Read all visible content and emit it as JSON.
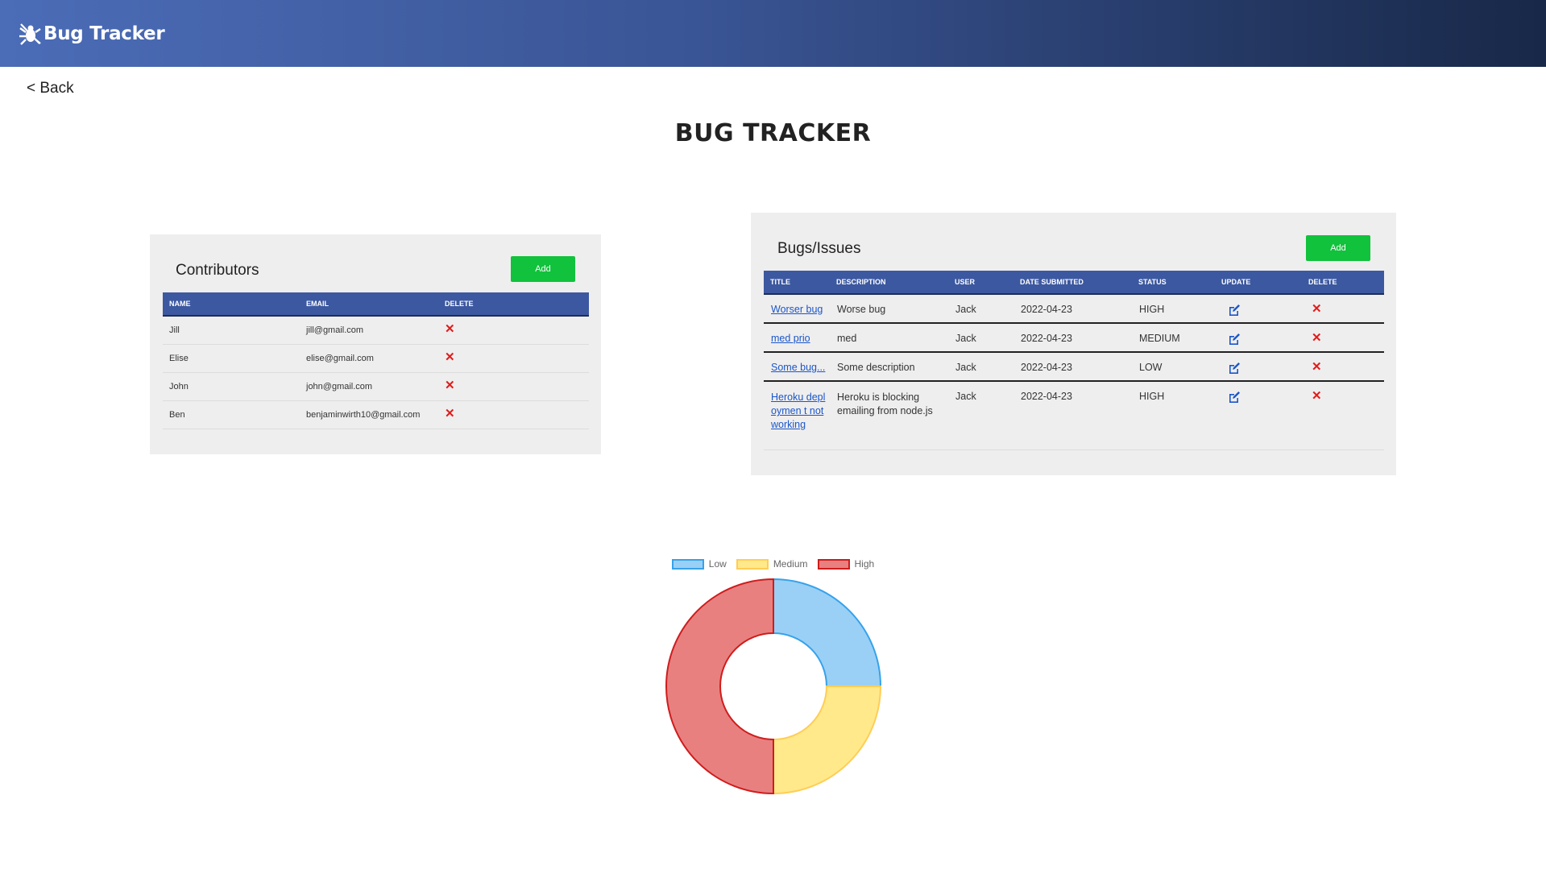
{
  "navbar": {
    "brand": "Bug Tracker",
    "icon": "bug-icon"
  },
  "back_label": "< Back",
  "page_title": "BUG TRACKER",
  "contributors": {
    "title": "Contributors",
    "add_label": "Add",
    "columns": [
      "NAME",
      "EMAIL",
      "DELETE"
    ],
    "rows": [
      {
        "name": "Jill",
        "email": "jill@gmail.com"
      },
      {
        "name": "Elise",
        "email": "elise@gmail.com"
      },
      {
        "name": "John",
        "email": "john@gmail.com"
      },
      {
        "name": "Ben",
        "email": "benjaminwirth10@gmail.com"
      }
    ]
  },
  "bugs": {
    "title": "Bugs/Issues",
    "add_label": "Add",
    "columns": [
      "TITLE",
      "DESCRIPTION",
      "USER",
      "DATE SUBMITTED",
      "STATUS",
      "UPDATE",
      "DELETE"
    ],
    "rows": [
      {
        "title": "Worser bug",
        "description": "Worse bug",
        "user": "Jack",
        "date": "2022-04-23",
        "status": "HIGH"
      },
      {
        "title": "med prio",
        "description": "med",
        "user": "Jack",
        "date": "2022-04-23",
        "status": "MEDIUM"
      },
      {
        "title": "Some bug...",
        "description": "Some description",
        "user": "Jack",
        "date": "2022-04-23",
        "status": "LOW"
      },
      {
        "title": "Heroku deploymen t not working",
        "description": "Heroku is blocking emailing from node.js",
        "user": "Jack",
        "date": "2022-04-23",
        "status": "HIGH"
      }
    ]
  },
  "colors": {
    "accent_green": "#11c23c",
    "table_header": "#3c58a0",
    "delete_red": "#e01b1b",
    "link_blue": "#1a56c9"
  },
  "chart_data": {
    "type": "pie",
    "variant": "doughnut",
    "categories": [
      "Low",
      "Medium",
      "High"
    ],
    "values": [
      1,
      1,
      2
    ],
    "colors": [
      {
        "fill": "#9ad0f5",
        "stroke": "#36a2eb"
      },
      {
        "fill": "#ffe98a",
        "stroke": "#ffcd56"
      },
      {
        "fill": "#e88080",
        "stroke": "#d01c1c"
      }
    ],
    "legend": "top"
  }
}
